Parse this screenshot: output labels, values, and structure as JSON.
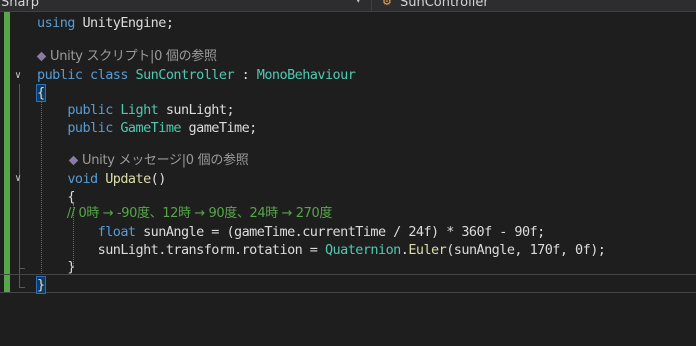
{
  "navbar": {
    "project_dropdown": "Sharp",
    "project_dropdown_arrow": "▾",
    "member_dropdown": "SunController",
    "member_icon": "class-icon"
  },
  "code_lens": {
    "class_refs": "Unity スクリプト|0 個の参照",
    "method_refs": "Unity メッセージ|0 個の参照",
    "icon": "unity-cube-icon"
  },
  "code": {
    "line_using_kw": "using",
    "line_using_rest": " UnityEngine;",
    "class_mod1": "public",
    "class_mod2": "class",
    "class_name": "SunController",
    "class_colon": " : ",
    "class_base": "MonoBehaviour",
    "open_brace": "{",
    "field1_kw": "public",
    "field1_type": "Light",
    "field1_name": " sunLight;",
    "field2_kw": "public",
    "field2_type": "GameTime",
    "field2_name": " gameTime;",
    "method_kw": "void",
    "method_name": "Update",
    "method_parens": "()",
    "method_open": "{",
    "comment": "// 0時 → -90度、12時 → 90度、24時 → 270度",
    "stmt1_kw": "float",
    "stmt1_rest": " sunAngle = (gameTime.currentTime / 24f) * 360f - 90f;",
    "stmt2_a": "sunLight.transform.rotation = ",
    "stmt2_type": "Quaternion",
    "stmt2_dot": ".",
    "stmt2_fn": "Euler",
    "stmt2_rest": "(sunAngle, 170f, 0f);",
    "method_close": "}",
    "close_brace": "}"
  },
  "colors": {
    "background": "#1e1e1e",
    "keyword": "#569cd6",
    "type": "#4ec9b0",
    "method": "#dcdcaa",
    "comment": "#57a64a",
    "change_margin": "#57a64a"
  }
}
